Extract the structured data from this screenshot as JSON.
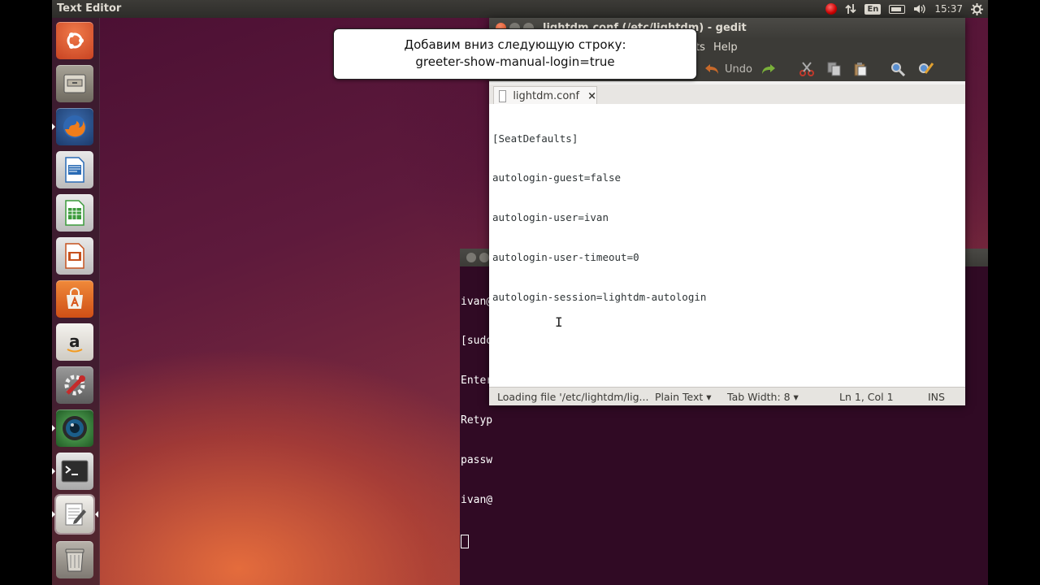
{
  "topbar": {
    "app_title": "Text Editor",
    "keyboard_layout": "En",
    "clock": "15:37"
  },
  "launcher": [
    {
      "name": "dash-home",
      "color": "#d84e2a"
    },
    {
      "name": "files",
      "color": "#8a8478"
    },
    {
      "name": "firefox",
      "color": "#e66a1d"
    },
    {
      "name": "libreoffice-writer",
      "color": "#2a6bb5"
    },
    {
      "name": "libreoffice-calc",
      "color": "#3c9b3c"
    },
    {
      "name": "libreoffice-impress",
      "color": "#c6521f"
    },
    {
      "name": "software-center",
      "color": "#dd5a1e"
    },
    {
      "name": "amazon",
      "color": "#e9e7e2"
    },
    {
      "name": "system-settings",
      "color": "#8a2a2a"
    },
    {
      "name": "shotwell",
      "color": "#2f7f3a"
    },
    {
      "name": "terminal",
      "color": "#2c2c2c"
    },
    {
      "name": "text-editor",
      "color": "#c8c6c0"
    },
    {
      "name": "trash",
      "color": "#8b8680"
    }
  ],
  "gedit": {
    "title": "lightdm.conf (/etc/lightdm) - gedit",
    "menu_help": "Help",
    "menu_partial": "ts",
    "toolbar_undo": "Undo",
    "tab_label": "lightdm.conf",
    "tab_close": "×",
    "lines": [
      "[SeatDefaults]",
      "autologin-guest=false",
      "autologin-user=ivan",
      "autologin-user-timeout=0",
      "autologin-session=lightdm-autologin"
    ],
    "status": {
      "message": "Loading file '/etc/lightdm/lig...",
      "language": "Plain Text ▾",
      "tab_width": "Tab Width: 8 ▾",
      "position": "Ln 1, Col 1",
      "mode": "INS"
    }
  },
  "terminal_lines": [
    "ivan@",
    "[sudo",
    "Enter",
    "Retyp",
    "passw",
    "ivan@"
  ],
  "tooltip": {
    "line1": "Добавим вниз следующую строку:",
    "line2": "greeter-show-manual-login=true"
  }
}
